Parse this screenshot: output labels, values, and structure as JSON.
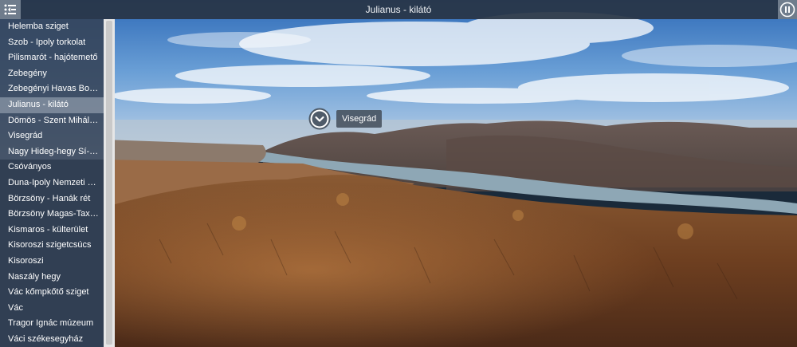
{
  "header": {
    "title": "Julianus - kilátó"
  },
  "icons": {
    "menu": "menu-collapse-icon",
    "pause": "pause-icon",
    "hotspot": "chevron-down-icon"
  },
  "sidebar": {
    "items": [
      {
        "label": "Helemba sziget",
        "active": false
      },
      {
        "label": "Szob - Ipoly torkolat",
        "active": false
      },
      {
        "label": "Pilismarót - hajótemető",
        "active": false
      },
      {
        "label": "Zebegény",
        "active": false
      },
      {
        "label": "Zebegényi Havas Boldogasszony",
        "active": false
      },
      {
        "label": "Julianus - kilátó",
        "active": true
      },
      {
        "label": "Dömös - Szent Mihály-hegy",
        "active": false
      },
      {
        "label": "Visegrád",
        "active": false
      },
      {
        "label": "Nagy Hideg-hegy Sí- és Turistaház",
        "active": false
      },
      {
        "label": "Csóványos",
        "active": false
      },
      {
        "label": "Duna-Ipoly Nemzeti Park",
        "active": false
      },
      {
        "label": "Börzsöny - Hanák rét",
        "active": false
      },
      {
        "label": "Börzsöny Magas-Taxi út",
        "active": false
      },
      {
        "label": "Kismaros - külterület",
        "active": false
      },
      {
        "label": "Kisoroszi szigetcsúcs",
        "active": false
      },
      {
        "label": "Kisoroszi",
        "active": false
      },
      {
        "label": "Naszály hegy",
        "active": false
      },
      {
        "label": "Vác kőmpkőtő sziget",
        "active": false
      },
      {
        "label": "Vác",
        "active": false
      },
      {
        "label": "Tragor Ignác múzeum",
        "active": false
      },
      {
        "label": "Váci székesegyház",
        "active": false
      }
    ]
  },
  "hotspot": {
    "label": "Visegrád"
  }
}
